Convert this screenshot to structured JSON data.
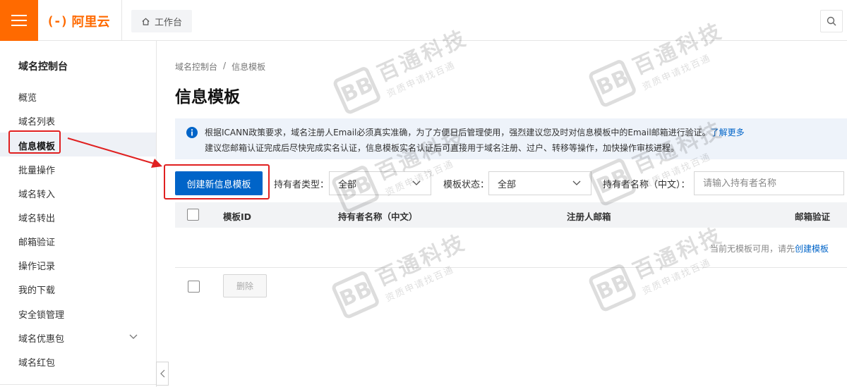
{
  "topbar": {
    "logo_mark": "(-)",
    "brand": "阿里云",
    "workbench_label": "工作台"
  },
  "sidebar": {
    "title": "域名控制台",
    "items": [
      {
        "label": "概览"
      },
      {
        "label": "域名列表"
      },
      {
        "label": "信息模板"
      },
      {
        "label": "批量操作"
      },
      {
        "label": "域名转入"
      },
      {
        "label": "域名转出"
      },
      {
        "label": "邮箱验证"
      },
      {
        "label": "操作记录"
      },
      {
        "label": "我的下载"
      },
      {
        "label": "安全锁管理"
      },
      {
        "label": "域名优惠包"
      },
      {
        "label": "域名红包"
      }
    ]
  },
  "breadcrumb": {
    "root": "域名控制台",
    "sep": "/",
    "current": "信息模板"
  },
  "page": {
    "title": "信息模板"
  },
  "notice": {
    "line1": "根据ICANN政策要求，域名注册人Email必须真实准确，为了方便日后管理使用，强烈建议您及时对信息模板中的Email邮箱进行验证。",
    "link": "了解更多",
    "line2": "建议您邮箱认证完成后尽快完成实名认证，信息模板实名认证后可直接用于域名注册、过户、转移等操作，加快操作审核进程。"
  },
  "filters": {
    "create_label": "创建新信息模板",
    "owner_type_label": "持有者类型：",
    "owner_type_value": "全部",
    "status_label": "模板状态：",
    "status_value": "全部",
    "owner_name_label": "持有者名称（中文）：",
    "owner_name_placeholder": "请输入持有者名称"
  },
  "table": {
    "columns": [
      "模板ID",
      "持有者名称（中文）",
      "注册人邮箱",
      "邮箱验证"
    ],
    "empty_text": "当前无模板可用，请先",
    "empty_link": "创建模板",
    "delete_label": "删除"
  },
  "watermark": {
    "logo": "BB",
    "text": "百通科技",
    "sub": "资质申请找百通"
  },
  "colors": {
    "brand_orange": "#ff6a00",
    "primary_blue": "#0064c8",
    "annotation_red": "#e02020"
  }
}
